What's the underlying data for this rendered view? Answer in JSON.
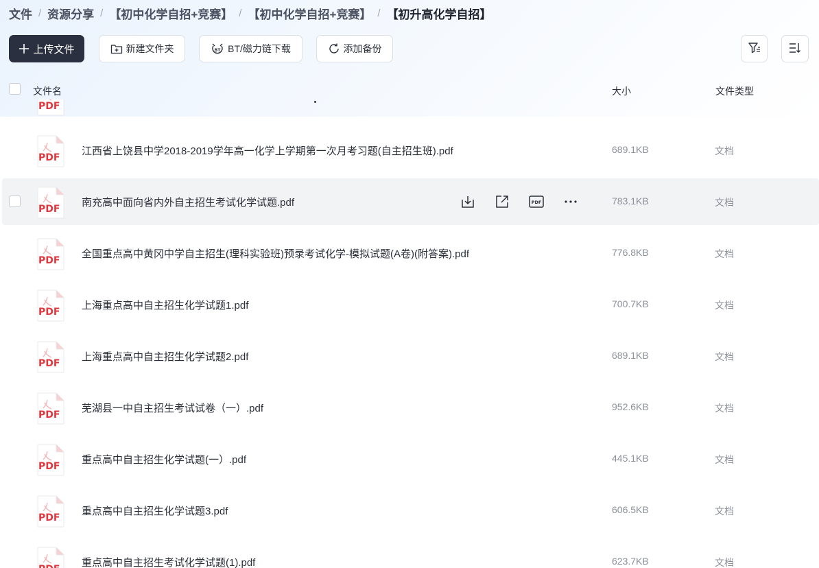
{
  "breadcrumb": [
    {
      "label": "文件"
    },
    {
      "label": "资源分享"
    },
    {
      "label": "【初中化学自招+竞赛】"
    },
    {
      "label": "【初中化学自招+竞赛】"
    },
    {
      "label": "【初升高化学自招】"
    }
  ],
  "toolbar": {
    "upload_label": "上传文件",
    "new_folder_label": "新建文件夹",
    "bt_label": "BT/磁力链下载",
    "backup_label": "添加备份"
  },
  "header": {
    "name": "文件名",
    "size": "大小",
    "type": "文件类型"
  },
  "icons": {
    "upload": "plus-icon",
    "new_folder": "folder-plus-icon",
    "bt": "bt-icon",
    "backup": "sync-icon",
    "filter": "filter-icon",
    "sort": "sort-icon",
    "file": "pdf-file-icon"
  },
  "file_icon_text": "PDF",
  "row_action_pdf_text": "PDF",
  "files": [
    {
      "name": "",
      "size": "",
      "type": ""
    },
    {
      "name": "江西省上饶县中学2018-2019学年高一化学上学期第一次月考习题(自主招生班).pdf",
      "size": "689.1KB",
      "type": "文档"
    },
    {
      "name": "南充高中面向省内外自主招生考试化学试题.pdf",
      "size": "783.1KB",
      "type": "文档"
    },
    {
      "name": "全国重点高中黄冈中学自主招生(理科实验班)预录考试化学-模拟试题(A卷)(附答案).pdf",
      "size": "776.8KB",
      "type": "文档"
    },
    {
      "name": "上海重点高中自主招生化学试题1.pdf",
      "size": "700.7KB",
      "type": "文档"
    },
    {
      "name": "上海重点高中自主招生化学试题2.pdf",
      "size": "689.1KB",
      "type": "文档"
    },
    {
      "name": "芜湖县一中自主招生考试试卷（一）.pdf",
      "size": "952.6KB",
      "type": "文档"
    },
    {
      "name": "重点高中自主招生化学试题(一）.pdf",
      "size": "445.1KB",
      "type": "文档"
    },
    {
      "name": "重点高中自主招生化学试题3.pdf",
      "size": "606.5KB",
      "type": "文档"
    },
    {
      "name": "重点高中自主招生考试化学试题(1).pdf",
      "size": "623.7KB",
      "type": "文档"
    }
  ],
  "hovered_row": 2,
  "colors": {
    "primary_button": "#2b3040",
    "pdf_red": "#e0383e",
    "hover_row": "#f2f3f5"
  }
}
